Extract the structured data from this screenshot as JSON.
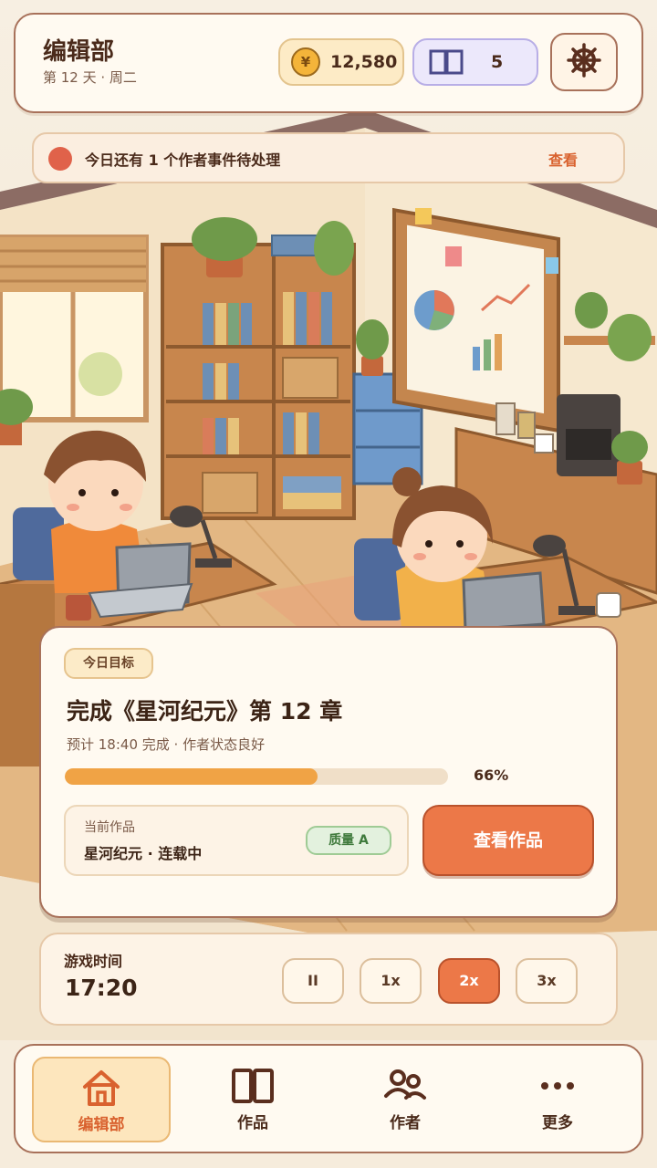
{
  "header": {
    "title": "编辑部",
    "subtitle": "第 12 天 · 周二",
    "coin_symbol": "¥",
    "coins": "12,580",
    "books": "5"
  },
  "notice": {
    "text": "今日还有 1 个作者事件待处理",
    "link": "查看"
  },
  "goal": {
    "tag": "今日目标",
    "title": "完成《星河纪元》第 12 章",
    "subtitle": "预计 18:40 完成 · 作者状态良好",
    "progress": 0.66,
    "progress_label": "66%",
    "current_label": "当前作品",
    "current_name": "星河纪元 · 连载中",
    "quality": "质量 A",
    "view_button": "查看作品"
  },
  "time": {
    "label": "游戏时间",
    "clock": "17:20",
    "speeds": [
      {
        "label": "II",
        "active": false
      },
      {
        "label": "1x",
        "active": false
      },
      {
        "label": "2x",
        "active": true
      },
      {
        "label": "3x",
        "active": false
      }
    ]
  },
  "nav": {
    "items": [
      {
        "label": "编辑部",
        "icon": "home-icon",
        "active": true
      },
      {
        "label": "作品",
        "icon": "book-icon",
        "active": false
      },
      {
        "label": "作者",
        "icon": "authors-icon",
        "active": false
      },
      {
        "label": "更多",
        "icon": "more-icon",
        "active": false
      }
    ]
  },
  "colors": {
    "accent": "#ec7848",
    "progress": "#f0a345",
    "border": "#a8715a",
    "panel": "#fffaf1"
  }
}
